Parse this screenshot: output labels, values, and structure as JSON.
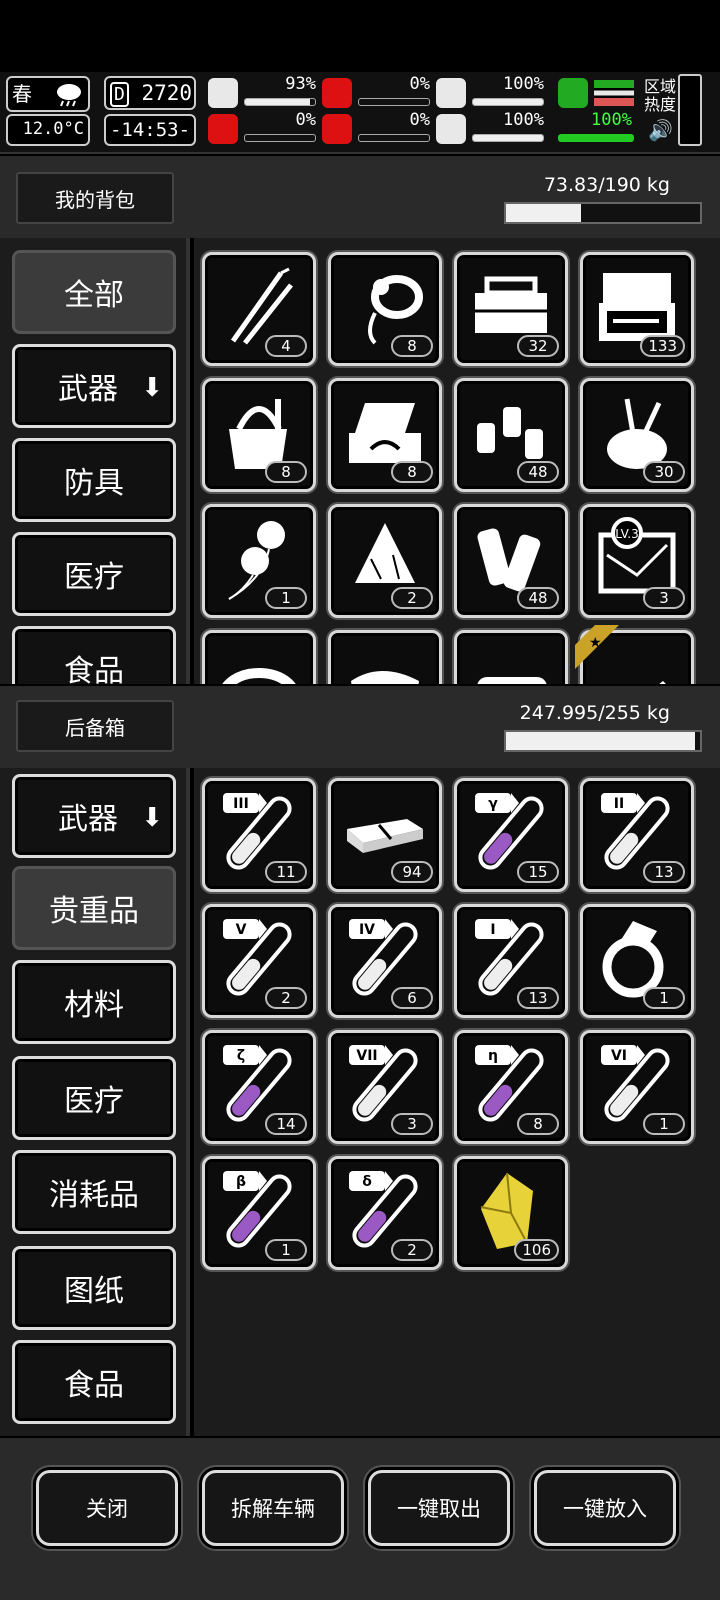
{
  "hud": {
    "season": "春",
    "temperature": "12.0°C",
    "day": "2720",
    "time": "-14:53-",
    "stats": [
      {
        "icon": "medkit-icon",
        "value": "93%",
        "level": 0.93
      },
      {
        "icon": "stomach-icon",
        "value": "0%",
        "level": 0.0
      },
      {
        "icon": "bandage-icon",
        "value": "100%",
        "level": 1.0
      },
      {
        "icon": "brain-icon",
        "value": "0%",
        "level": 0.0
      },
      {
        "icon": "blood-drop-icon",
        "value": "0%",
        "level": 0.0
      },
      {
        "icon": "heart-icon",
        "value": "100%",
        "level": 1.0
      }
    ],
    "stamina": "100%",
    "zone_heat": "区域\n热度"
  },
  "backpack": {
    "title": "我的背包",
    "weight": "73.83/190 kg",
    "weight_fill": 0.388,
    "categories": [
      {
        "label": "全部",
        "active": true
      },
      {
        "label": "武器",
        "arrow": true
      },
      {
        "label": "防具"
      },
      {
        "label": "医疗"
      },
      {
        "label": "食品"
      }
    ],
    "items": [
      {
        "icon": "lockpick-icon",
        "count": "4"
      },
      {
        "icon": "rope-icon",
        "count": "8"
      },
      {
        "icon": "toolbox-icon",
        "count": "32"
      },
      {
        "icon": "tool-case-icon",
        "count": "133"
      },
      {
        "icon": "tool-bag-icon",
        "count": "8"
      },
      {
        "icon": "repair-kit-icon",
        "count": "8"
      },
      {
        "icon": "chemical-bottles-icon",
        "count": "48"
      },
      {
        "icon": "brush-pot-icon",
        "count": "30"
      },
      {
        "icon": "balloon-icon",
        "count": "1"
      },
      {
        "icon": "cloth-icon",
        "count": "2"
      },
      {
        "icon": "bandage-roll-icon",
        "count": "48"
      },
      {
        "icon": "map-lv3-icon",
        "count": "3",
        "label": "LV.3"
      },
      {
        "icon": "disc-icon",
        "count": ""
      },
      {
        "icon": "rag-icon",
        "count": ""
      },
      {
        "icon": "scroll-icon",
        "count": ""
      },
      {
        "icon": "starred-gun-icon",
        "count": ""
      }
    ]
  },
  "trunk": {
    "title": "后备箱",
    "weight": "247.995/255 kg",
    "weight_fill": 0.972,
    "categories": [
      {
        "label": "武器",
        "arrow": true
      },
      {
        "label": "贵重品",
        "active": true
      },
      {
        "label": "材料"
      },
      {
        "label": "医疗"
      },
      {
        "label": "消耗品"
      },
      {
        "label": "图纸"
      },
      {
        "label": "食品"
      }
    ],
    "items": [
      {
        "icon": "vial-icon",
        "tag": "III",
        "count": "11",
        "liquid": "#eee"
      },
      {
        "icon": "cash-bundle-icon",
        "count": "94"
      },
      {
        "icon": "vial-icon",
        "tag": "γ",
        "count": "15",
        "liquid": "#9b59c4"
      },
      {
        "icon": "vial-icon",
        "tag": "II",
        "count": "13",
        "liquid": "#eee"
      },
      {
        "icon": "vial-icon",
        "tag": "V",
        "count": "2",
        "liquid": "#eee"
      },
      {
        "icon": "vial-icon",
        "tag": "IV",
        "count": "6",
        "liquid": "#eee"
      },
      {
        "icon": "vial-icon",
        "tag": "I",
        "count": "13",
        "liquid": "#eee"
      },
      {
        "icon": "ring-icon",
        "count": "1"
      },
      {
        "icon": "vial-icon",
        "tag": "ζ",
        "count": "14",
        "liquid": "#9b59c4"
      },
      {
        "icon": "vial-icon",
        "tag": "VII",
        "count": "3",
        "liquid": "#eee"
      },
      {
        "icon": "vial-icon",
        "tag": "η",
        "count": "8",
        "liquid": "#9b59c4"
      },
      {
        "icon": "vial-icon",
        "tag": "VI",
        "count": "1",
        "liquid": "#eee"
      },
      {
        "icon": "vial-icon",
        "tag": "β",
        "count": "1",
        "liquid": "#9b59c4"
      },
      {
        "icon": "vial-icon",
        "tag": "δ",
        "count": "2",
        "liquid": "#9b59c4"
      },
      {
        "icon": "gold-crystal-icon",
        "count": "106"
      }
    ]
  },
  "footer": {
    "buttons": [
      "关闭",
      "拆解车辆",
      "一键取出",
      "一键放入"
    ]
  },
  "colors": {
    "purple_liquid": "#9b59c4",
    "gold": "#e8d23a",
    "accent_red": "#dd1111",
    "accent_green": "#22aa22"
  }
}
